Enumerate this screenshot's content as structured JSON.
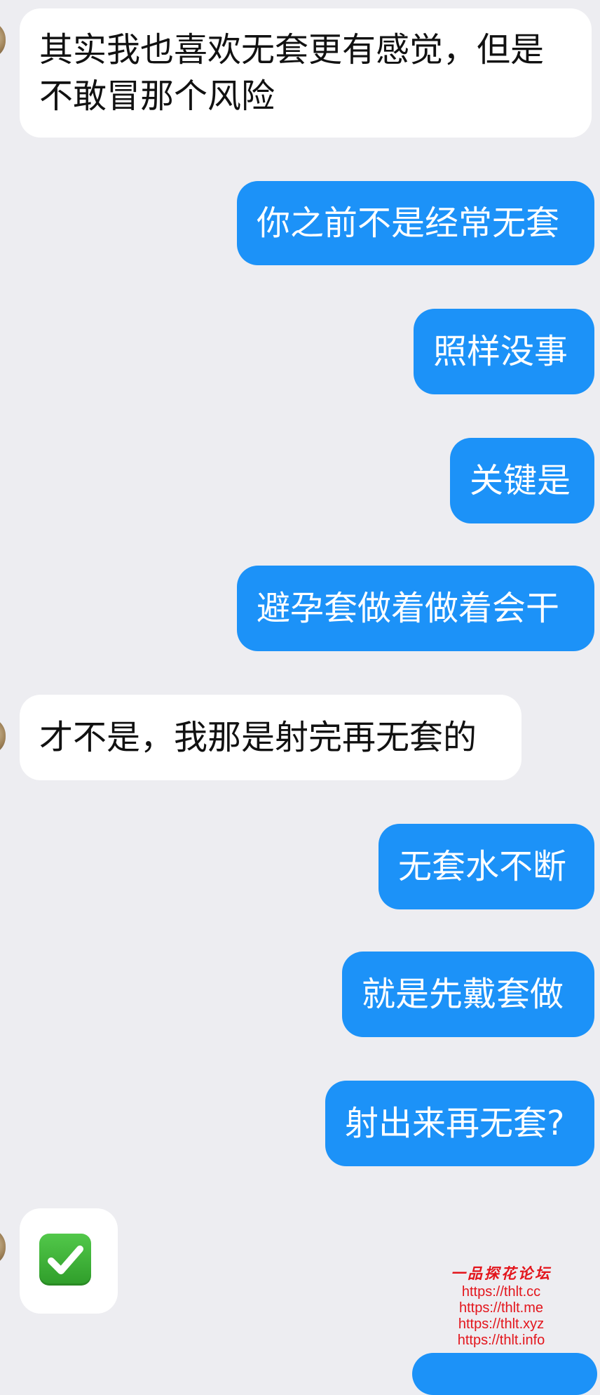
{
  "messages": [
    {
      "from": "them",
      "text": "其实我也喜欢无套更有感觉，但是\n不敢冒那个风险"
    },
    {
      "from": "me",
      "text": "你之前不是经常无套"
    },
    {
      "from": "me",
      "text": "照样没事"
    },
    {
      "from": "me",
      "text": "关键是"
    },
    {
      "from": "me",
      "text": "避孕套做着做着会干"
    },
    {
      "from": "them",
      "text": "才不是，我那是射完再无套的"
    },
    {
      "from": "me",
      "text": "无套水不断"
    },
    {
      "from": "me",
      "text": "就是先戴套做"
    },
    {
      "from": "me",
      "text": "射出来再无套?"
    },
    {
      "from": "them",
      "emoji": "check-mark-button-icon"
    }
  ],
  "watermark": {
    "title": "一品探花论坛",
    "urls": [
      "https://thlt.cc",
      "https://thlt.me",
      "https://thlt.xyz",
      "https://thlt.info"
    ]
  },
  "colors": {
    "background": "#ededf1",
    "incoming_bubble": "#ffffff",
    "outgoing_bubble": "#1c92f8",
    "watermark": "#e3151c"
  }
}
